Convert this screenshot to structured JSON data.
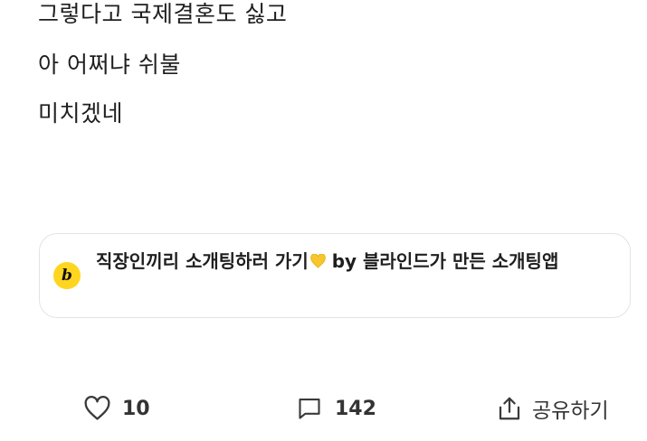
{
  "post": {
    "lines": [
      "그렇다고 국제결혼도 싫고",
      "아 어쩌냐 쉬불",
      "미치겠네"
    ]
  },
  "ad": {
    "logo_letter": "b",
    "text": "직장인끼리 소개팅하러 가기",
    "text_after": " by 블라인드가 만든 소개팅앱",
    "heart_color": "#f7c62f"
  },
  "actions": {
    "like_count": "10",
    "comment_count": "142",
    "share_label": "공유하기"
  }
}
